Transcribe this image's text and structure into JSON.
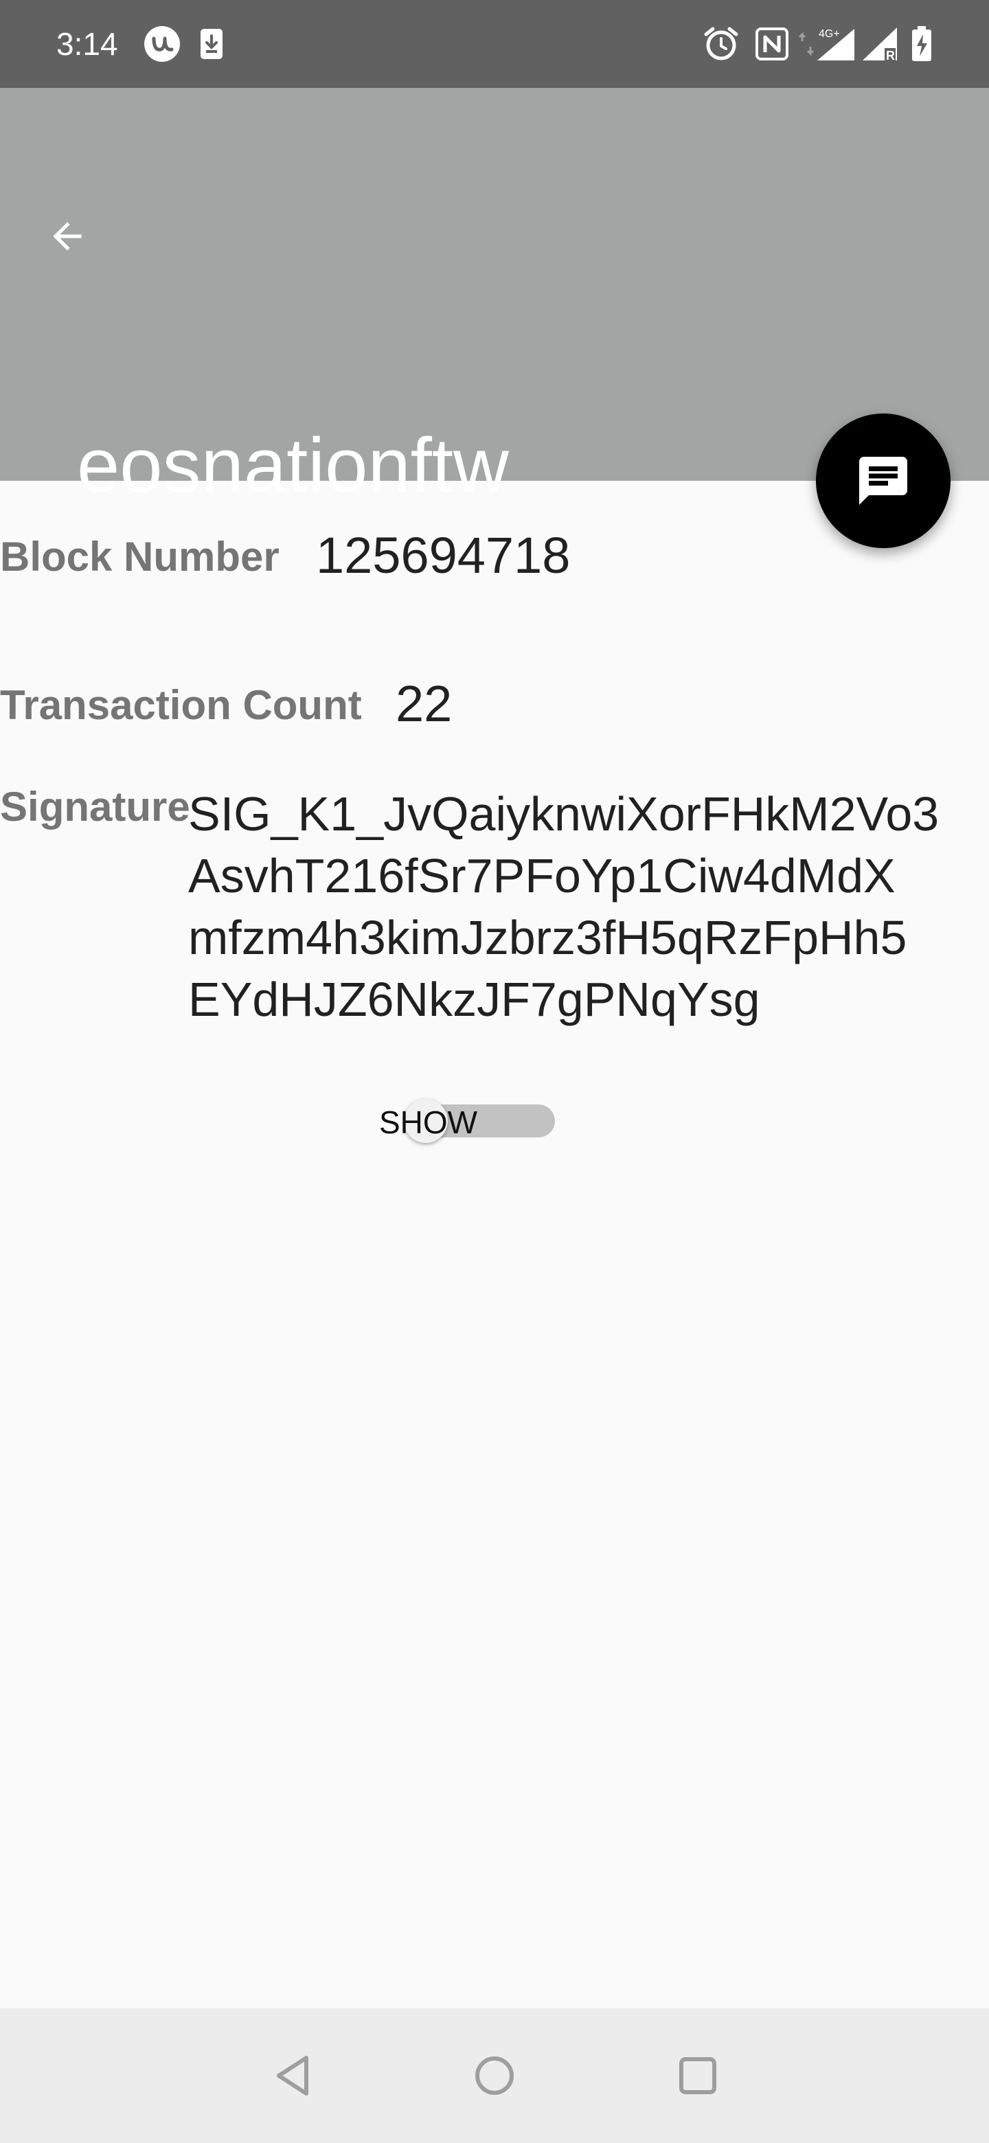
{
  "status_bar": {
    "time": "3:14",
    "icons": [
      "u-app-icon",
      "download-icon",
      "alarm-icon",
      "nfc-icon",
      "data-arrows-icon",
      "signal-4g-icon",
      "signal-roaming-icon",
      "battery-charging-icon"
    ],
    "network_label": "4G+",
    "roaming_label": "R"
  },
  "app_bar": {
    "title": "eosnationftw",
    "back_icon": "arrow-back-icon"
  },
  "fab": {
    "icon": "message-icon"
  },
  "details": {
    "block_number_label": "Block Number",
    "block_number_value": "125694718",
    "transaction_count_label": "Transaction Count",
    "transaction_count_value": "22",
    "signature_label": "Signature",
    "signature_lines": [
      "SIG_K1_JvQaiyknwiXorFHkM2Vo3",
      "AsvhT216fSr7PFoYp1Ciw4dMdX",
      "mfzm4h3kimJzbrz3fH5qRzFpHh5",
      "EYdHJZ6NkzJF7gPNqYsg"
    ]
  },
  "toggle": {
    "label": "SHOW",
    "checked": false
  },
  "nav_bar": {
    "buttons": [
      "back-triangle-icon",
      "home-circle-icon",
      "recents-square-icon"
    ]
  },
  "colors": {
    "status_bar": "#616161",
    "app_bar": "#a2a5a4",
    "background": "#fafafa",
    "fab": "#000000",
    "label_text": "#757575",
    "value_text": "#212121",
    "nav_bar": "#ececec"
  }
}
